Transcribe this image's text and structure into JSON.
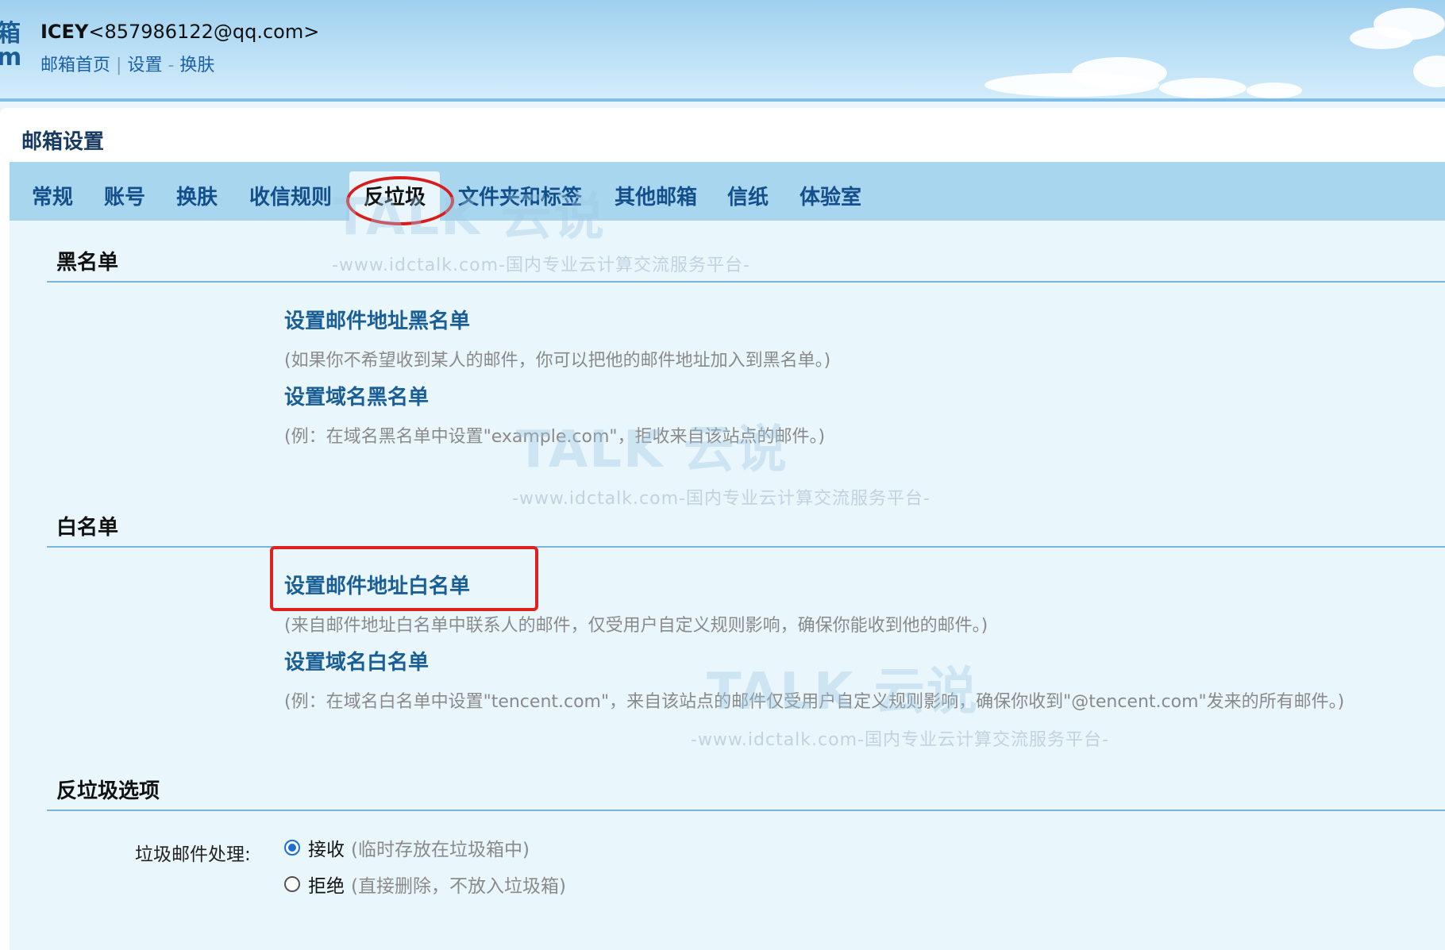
{
  "header": {
    "logo_fragment": "箱\nm",
    "user_name": "ICEY",
    "user_email": "<857986122@qq.com>",
    "links": [
      "邮箱首页",
      "设置",
      "换肤"
    ],
    "separator_pipe": "|",
    "separator_dash": "-"
  },
  "panel_title": "邮箱设置",
  "tabs": [
    {
      "label": "常规"
    },
    {
      "label": "账号"
    },
    {
      "label": "换肤"
    },
    {
      "label": "收信规则"
    },
    {
      "label": "反垃圾",
      "active": true
    },
    {
      "label": "文件夹和标签"
    },
    {
      "label": "其他邮箱"
    },
    {
      "label": "信纸"
    },
    {
      "label": "体验室"
    }
  ],
  "blacklist": {
    "heading": "黑名单",
    "items": [
      {
        "title": "设置邮件地址黑名单",
        "desc": "(如果你不希望收到某人的邮件，你可以把他的邮件地址加入到黑名单。)"
      },
      {
        "title": "设置域名黑名单",
        "desc": "(例：在域名黑名单中设置\"example.com\"，拒收来自该站点的邮件。)"
      }
    ]
  },
  "whitelist": {
    "heading": "白名单",
    "items": [
      {
        "title": "设置邮件地址白名单",
        "desc": "(来自邮件地址白名单中联系人的邮件，仅受用户自定义规则影响，确保你能收到他的邮件。)"
      },
      {
        "title": "设置域名白名单",
        "desc": "(例：在域名白名单中设置\"tencent.com\"，来自该站点的邮件仅受用户自定义规则影响，确保你收到\"@tencent.com\"发来的所有邮件。)"
      }
    ]
  },
  "antispam_options": {
    "heading": "反垃圾选项",
    "label": "垃圾邮件处理:",
    "options": [
      {
        "label": "接收",
        "note": "(临时存放在垃圾箱中)",
        "checked": true
      },
      {
        "label": "拒绝",
        "note": "(直接删除，不放入垃圾箱)",
        "checked": false
      }
    ]
  },
  "watermark": {
    "logo": "TALK 云说",
    "sub": "-www.idctalk.com-国内专业云计算交流服务平台-"
  },
  "colors": {
    "link": "#1a5e96",
    "tabbar": "#a9d6ef",
    "content_bg": "#e9f6fc",
    "highlight_red": "#d91c1c",
    "radio_checked": "#1a6fd6"
  }
}
